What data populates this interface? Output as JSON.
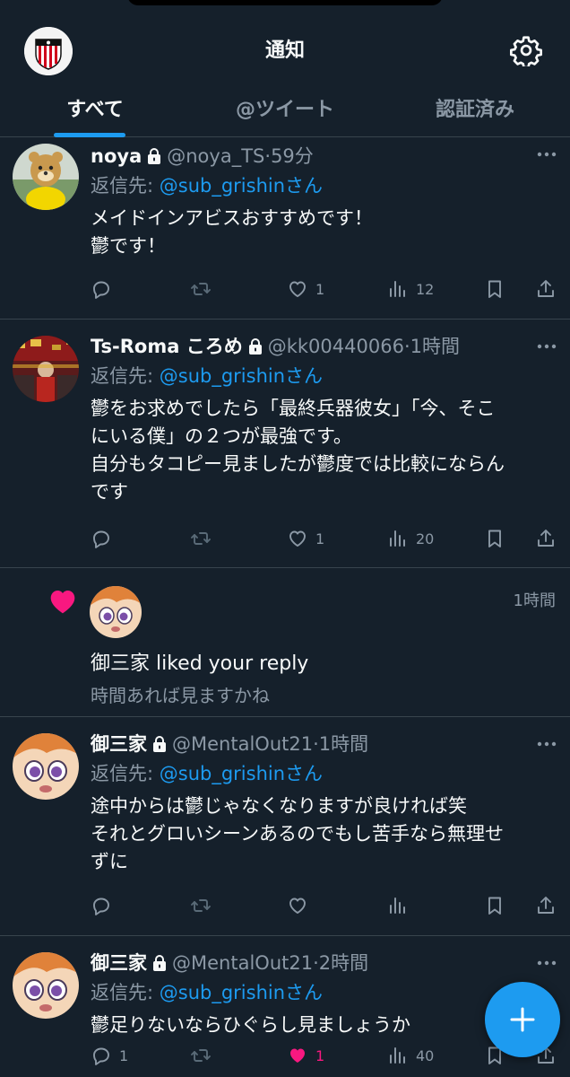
{
  "header": {
    "title": "通知"
  },
  "tabs": [
    {
      "label": "すべて",
      "active": true
    },
    {
      "label": "@ツイート",
      "active": false
    },
    {
      "label": "認証済み",
      "active": false
    }
  ],
  "items": [
    {
      "name": "noya",
      "handle": "@noya_TS",
      "time": "59分",
      "reply_prefix": "返信先: ",
      "reply_user": "@sub_grishin",
      "reply_suffix": "さん",
      "text": "メイドインアビスおすすめです！\n鬱です！",
      "reply_count": "",
      "retweet_count": "",
      "like_count": "1",
      "view_count": "12"
    },
    {
      "name": "Ts-Roma ころめ",
      "handle": "@kk00440066",
      "time": "1時間",
      "reply_prefix": "返信先: ",
      "reply_user": "@sub_grishin",
      "reply_suffix": "さん",
      "text": "鬱をお求めでしたら「最終兵器彼女」「今、そこ\nにいる僕」の２つが最強です。\n自分もタコピー見ましたが鬱度では比較にならん\nです",
      "reply_count": "",
      "retweet_count": "",
      "like_count": "1",
      "view_count": "20"
    },
    {
      "name": "御三家",
      "handle": "@MentalOut21",
      "time": "1時間",
      "reply_prefix": "返信先: ",
      "reply_user": "@sub_grishin",
      "reply_suffix": "さん",
      "text": "途中からは鬱じゃなくなりますが良ければ笑\nそれとグロいシーンあるのでもし苦手なら無理せ\nずに",
      "reply_count": "",
      "retweet_count": "",
      "like_count": "",
      "view_count": ""
    },
    {
      "name": "御三家",
      "handle": "@MentalOut21",
      "time": "2時間",
      "reply_prefix": "返信先: ",
      "reply_user": "@sub_grishin",
      "reply_suffix": "さん",
      "text": "鬱足りないならひぐらし見ましょうか",
      "reply_count": "1",
      "retweet_count": "",
      "like_count": "1",
      "view_count": "40"
    }
  ],
  "like_notification": {
    "time": "1時間",
    "text": "御三家 liked your reply",
    "quoted": "時間あれば見ますかね"
  },
  "separator": "·",
  "colors": {
    "background": "#15202b",
    "accent": "#1d9bf0",
    "like": "#f91880",
    "muted": "#8b98a5",
    "divider": "#38444d"
  }
}
